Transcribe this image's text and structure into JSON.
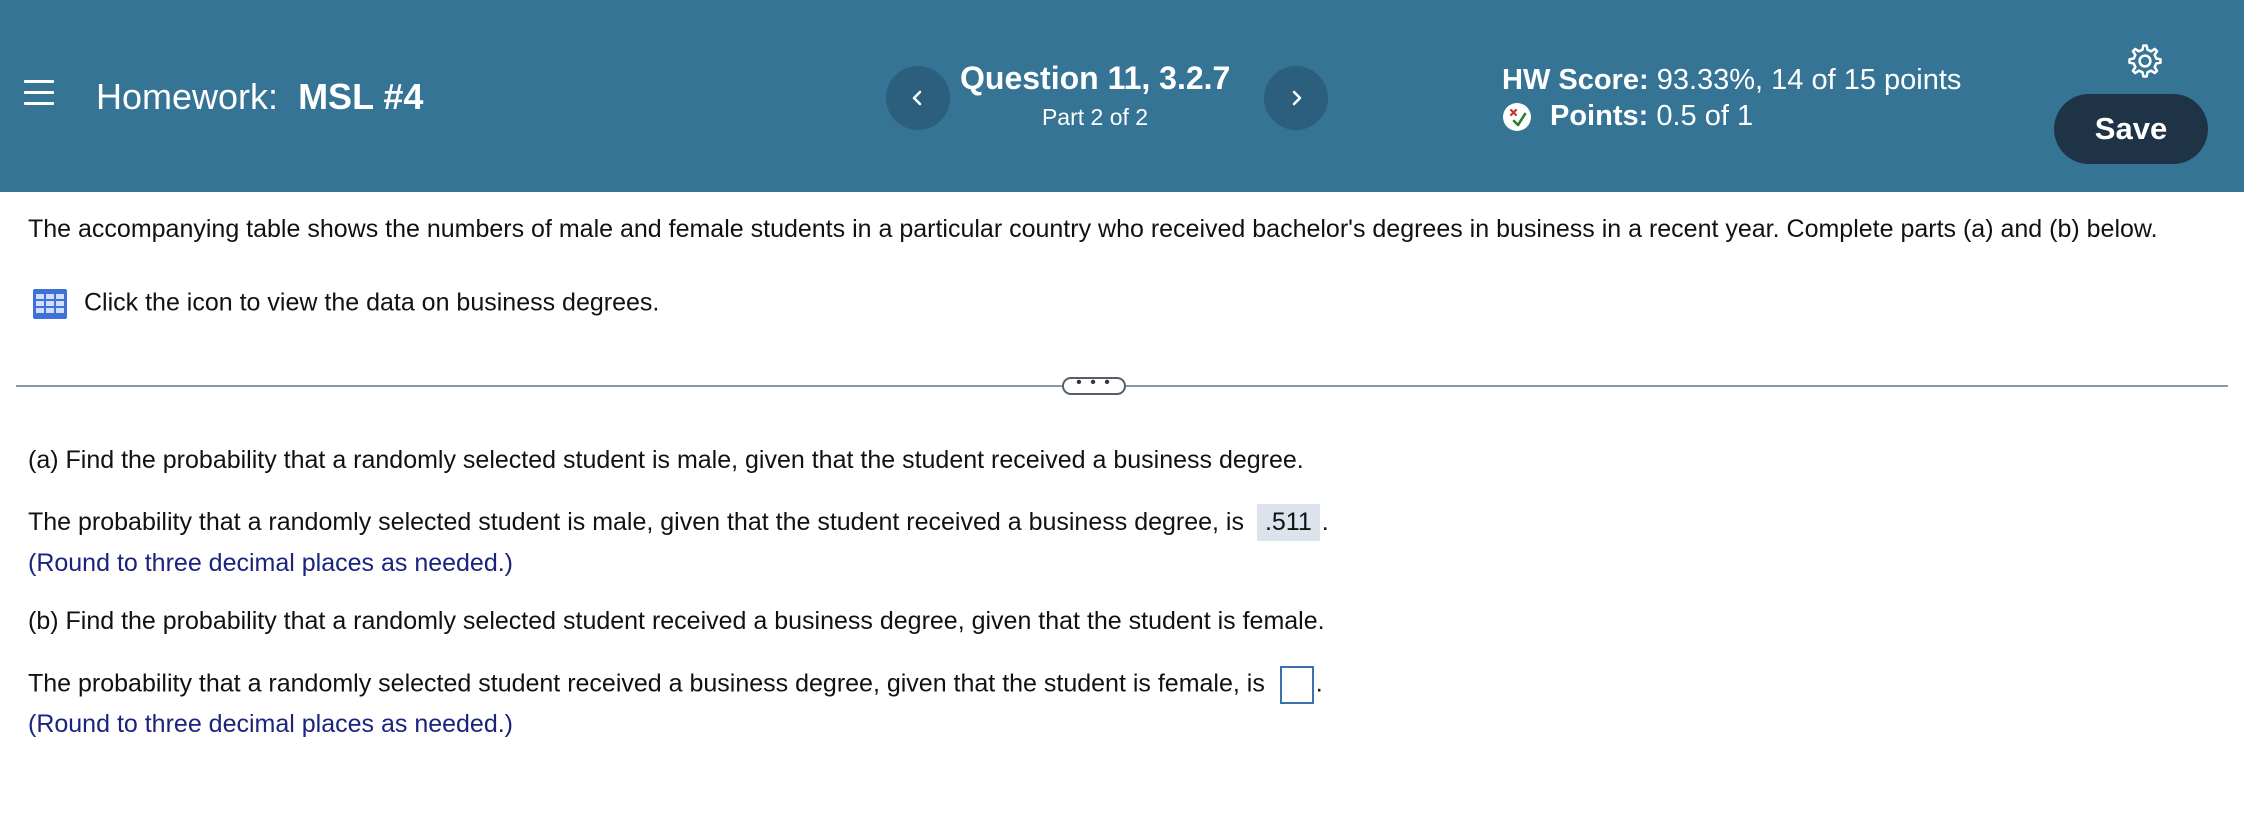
{
  "header": {
    "homework_label": "Homework:",
    "homework_name": "MSL #4",
    "question_title": "Question 11, 3.2.7",
    "question_part": "Part 2 of 2",
    "score_label": "HW Score:",
    "score_value": "93.33%, 14 of 15 points",
    "points_label": "Points:",
    "points_value": "0.5 of 1",
    "save_label": "Save"
  },
  "intro": {
    "text": "The accompanying table shows the numbers of male and female students in a particular country who received bachelor's degrees in business in a recent year. Complete parts (a) and (b) below.",
    "view_data_label": "Click the icon to view the data on business degrees."
  },
  "expand_label": "• • •",
  "part_a": {
    "question": "(a) Find the probability that a randomly selected student is male, given that the student received a business degree.",
    "answer_prefix": "The probability that a randomly selected student is male, given that the student received a business degree, is",
    "answer_value": ".511",
    "answer_suffix": ".",
    "hint": "(Round to three decimal places as needed.)"
  },
  "part_b": {
    "question": "(b) Find the probability that a randomly selected student received a business degree, given that the student is female.",
    "answer_prefix": "The probability that a randomly selected student received a business degree, given that the student is female, is",
    "answer_value": "",
    "answer_suffix": ".",
    "hint": "(Round to three decimal places as needed.)"
  },
  "colors": {
    "header_bg": "#367496",
    "save_bg": "#1f3346",
    "hint_text": "#1a237e"
  },
  "icons": [
    "menu-icon",
    "chevron-left-icon",
    "chevron-right-icon",
    "gear-icon",
    "partial-credit-icon",
    "table-icon"
  ]
}
